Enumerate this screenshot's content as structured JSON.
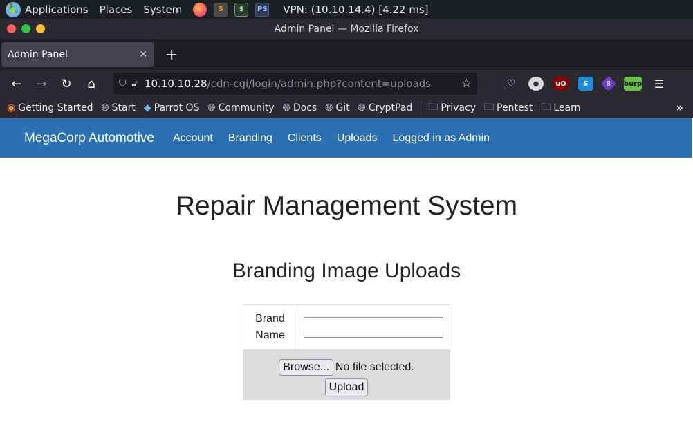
{
  "system": {
    "menu": [
      "Applications",
      "Places",
      "System"
    ],
    "vpn": "VPN: (10.10.14.4) [4.22 ms]",
    "tray_icons": [
      "firefox-icon",
      "sublime-icon",
      "terminal-icon",
      "powershell-icon"
    ]
  },
  "window": {
    "title": "Admin Panel — Mozilla Firefox"
  },
  "tabs": [
    {
      "label": "Admin Panel"
    }
  ],
  "url": {
    "host": "10.10.10.28",
    "path": "/cdn-cgi/login/admin.php?content=uploads"
  },
  "extensions": {
    "wappalyzer_badge": "8",
    "burp_label": "burp"
  },
  "bookmarks": [
    "Getting Started",
    "Start",
    "Parrot OS",
    "Community",
    "Docs",
    "Git",
    "CryptPad"
  ],
  "bookmark_folders": [
    "Privacy",
    "Pentest",
    "Learn"
  ],
  "site": {
    "brand": "MegaCorp Automotive",
    "nav": [
      "Account",
      "Branding",
      "Clients",
      "Uploads",
      "Logged in as Admin"
    ]
  },
  "page": {
    "title": "Repair Management System",
    "subtitle": "Branding Image Uploads",
    "form": {
      "brand_label_line1": "Brand",
      "brand_label_line2": "Name",
      "brand_value": "",
      "browse_label": "Browse...",
      "file_status": "No file selected.",
      "upload_label": "Upload"
    }
  }
}
